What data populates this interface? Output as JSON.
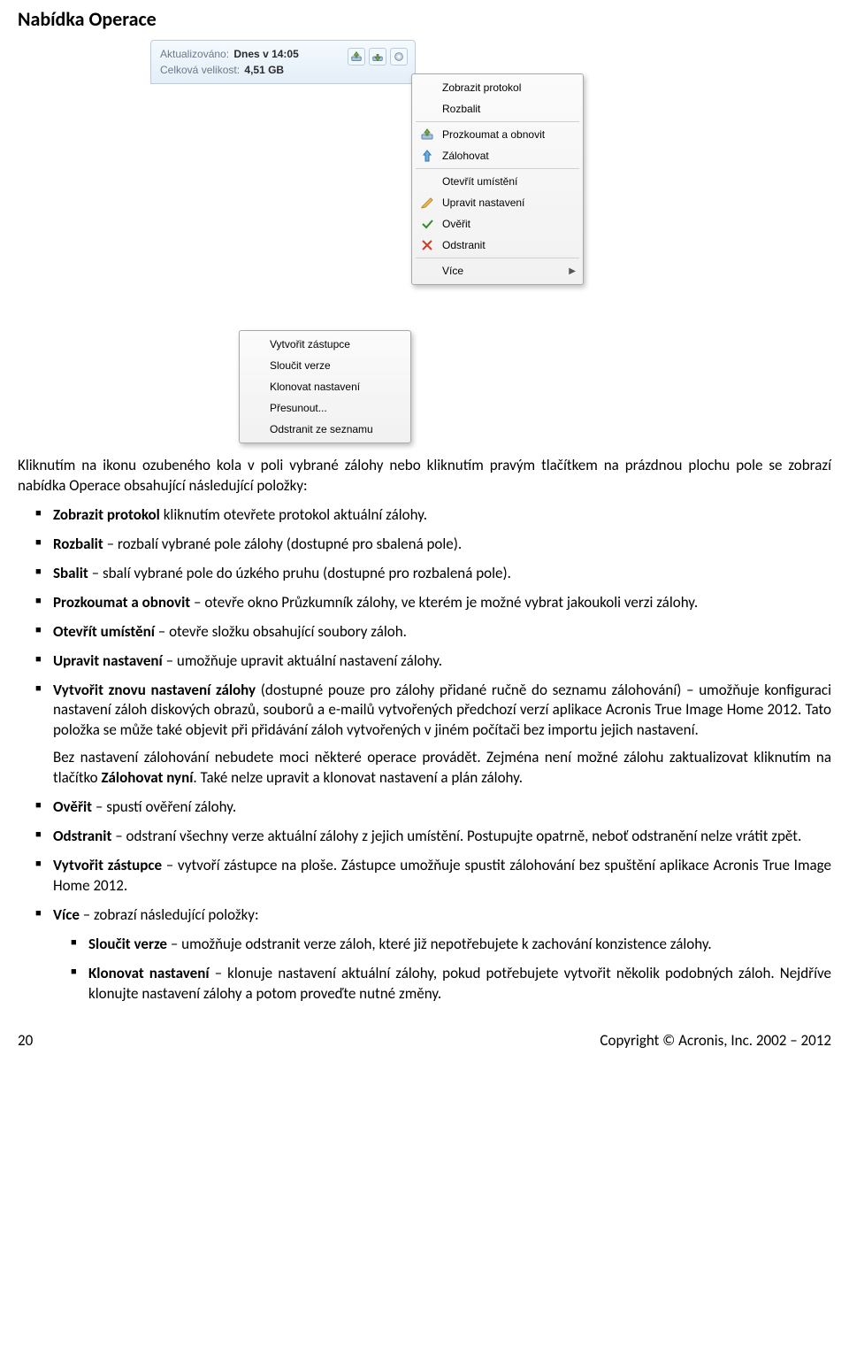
{
  "heading": "Nabídka Operace",
  "toolbar": {
    "updated_label": "Aktualizováno:",
    "updated_value": "Dnes v 14:05",
    "size_label": "Celková velikost:",
    "size_value": "4,51 GB"
  },
  "menu": {
    "show_protocol": "Zobrazit protokol",
    "expand": "Rozbalit",
    "explore_restore": "Prozkoumat a obnovit",
    "backup": "Zálohovat",
    "open_location": "Otevřít umístění",
    "edit_settings": "Upravit nastavení",
    "validate": "Ověřit",
    "remove": "Odstranit",
    "more": "Více"
  },
  "submenu": {
    "create_shortcut": "Vytvořit zástupce",
    "merge_versions": "Sloučit verze",
    "clone_settings": "Klonovat nastavení",
    "move": "Přesunout...",
    "remove_from_list": "Odstranit ze seznamu"
  },
  "intro": "Kliknutím na ikonu ozubeného kola v poli vybrané zálohy nebo kliknutím pravým tlačítkem na prázdnou plochu pole se zobrazí nabídka Operace obsahující následující položky:",
  "items": {
    "show_protocol": {
      "b": "Zobrazit protokol",
      "t": " kliknutím otevřete protokol aktuální zálohy."
    },
    "expand": {
      "b": "Rozbalit",
      "t": " – rozbalí vybrané pole zálohy (dostupné pro sbalená pole)."
    },
    "collapse": {
      "b": "Sbalit",
      "t": " – sbalí vybrané pole do úzkého pruhu (dostupné pro rozbalená pole)."
    },
    "explore": {
      "b": "Prozkoumat a obnovit",
      "t": " – otevře okno Průzkumník zálohy, ve kterém je možné vybrat jakoukoli verzi zálohy."
    },
    "open_loc": {
      "b": "Otevřít umístění",
      "t": " – otevře složku obsahující soubory záloh."
    },
    "edit": {
      "b": "Upravit nastavení",
      "t": "  – umožňuje upravit aktuální nastavení zálohy."
    },
    "recreate": {
      "b": "Vytvořit znovu nastavení zálohy",
      "t": " (dostupné pouze pro zálohy přidané ručně do seznamu zálohování) – umožňuje konfiguraci nastavení záloh diskových obrazů, souborů a e-mailů vytvořených předchozí verzí aplikace Acronis True Image Home 2012. Tato položka se může také objevit při přidávání záloh vytvořených v jiném počítači bez importu jejich nastavení.",
      "p2a": "Bez nastavení zálohování nebudete moci některé operace provádět. Zejména není možné zálohu zaktualizovat kliknutím na tlačítko ",
      "p2b": "Zálohovat nyní",
      "p2c": ". Také nelze upravit a klonovat nastavení a plán zálohy."
    },
    "validate": {
      "b": "Ověřit",
      "t": "  – spustí ověření zálohy."
    },
    "remove": {
      "b": "Odstranit",
      "t": "  – odstraní všechny verze aktuální zálohy z jejich umístění. Postupujte opatrně, neboť odstranění nelze vrátit zpět."
    },
    "shortcut": {
      "b": "Vytvořit zástupce",
      "t": " – vytvoří zástupce na ploše. Zástupce umožňuje spustit zálohování bez spuštění aplikace Acronis True Image Home 2012."
    },
    "more": {
      "b": "Více",
      "t": " – zobrazí následující položky:"
    },
    "merge": {
      "b": "Sloučit verze",
      "t": " – umožňuje odstranit verze záloh, které již nepotřebujete k zachování konzistence zálohy."
    },
    "clone": {
      "b": "Klonovat nastavení",
      "t": " – klonuje nastavení aktuální zálohy, pokud potřebujete vytvořit několik podobných záloh. Nejdříve klonujte nastavení zálohy a potom proveďte nutné změny."
    }
  },
  "footer": {
    "page": "20",
    "copyright": "Copyright © Acronis, Inc. 2002 – 2012"
  }
}
